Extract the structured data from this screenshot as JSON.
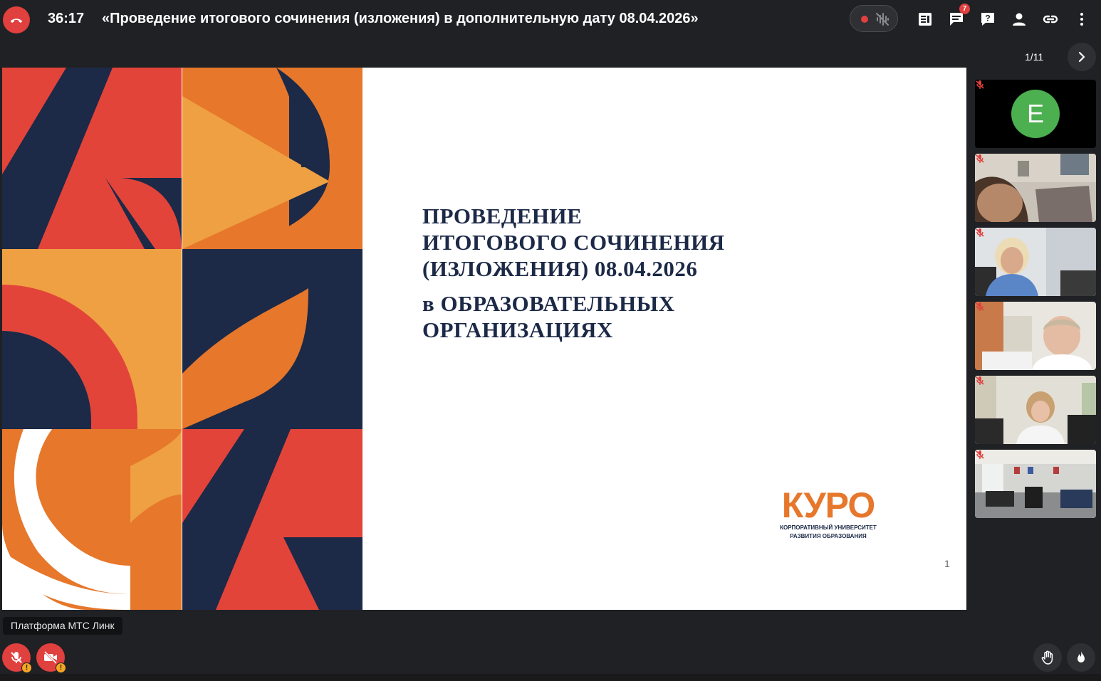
{
  "call": {
    "timer": "36:17",
    "title": "«Проведение итогового сочинения (изложения) в дополнительную дату 08.04.2026»",
    "chat_badge": "7"
  },
  "presentation": {
    "page_counter": "1/11",
    "slide_title_lines": [
      "ПРОВЕДЕНИЕ",
      "ИТОГОВОГО СОЧИНЕНИЯ",
      "(ИЗЛОЖЕНИЯ) 08.04.2026",
      "в ОБРАЗОВАТЕЛЬНЫХ",
      "ОРГАНИЗАЦИЯХ"
    ],
    "logo_word": "КУРО",
    "logo_sub_lines": [
      "КОРПОРАТИВНЫЙ УНИВЕРСИТЕТ",
      "РАЗВИТИЯ ОБРАЗОВАНИЯ"
    ],
    "slide_number": "1"
  },
  "participants": [
    {
      "avatar_letter": "E",
      "muted": true,
      "video": false
    },
    {
      "muted": true,
      "video": true
    },
    {
      "muted": true,
      "video": true
    },
    {
      "muted": true,
      "video": true
    },
    {
      "muted": true,
      "video": true
    },
    {
      "muted": true,
      "video": true
    }
  ],
  "footer": {
    "tooltip": "Платформа МТС Линк"
  },
  "colors": {
    "accent_red": "#e0403e",
    "navy": "#1c2947",
    "orange": "#e6772b",
    "avatar_green": "#4caf50"
  }
}
